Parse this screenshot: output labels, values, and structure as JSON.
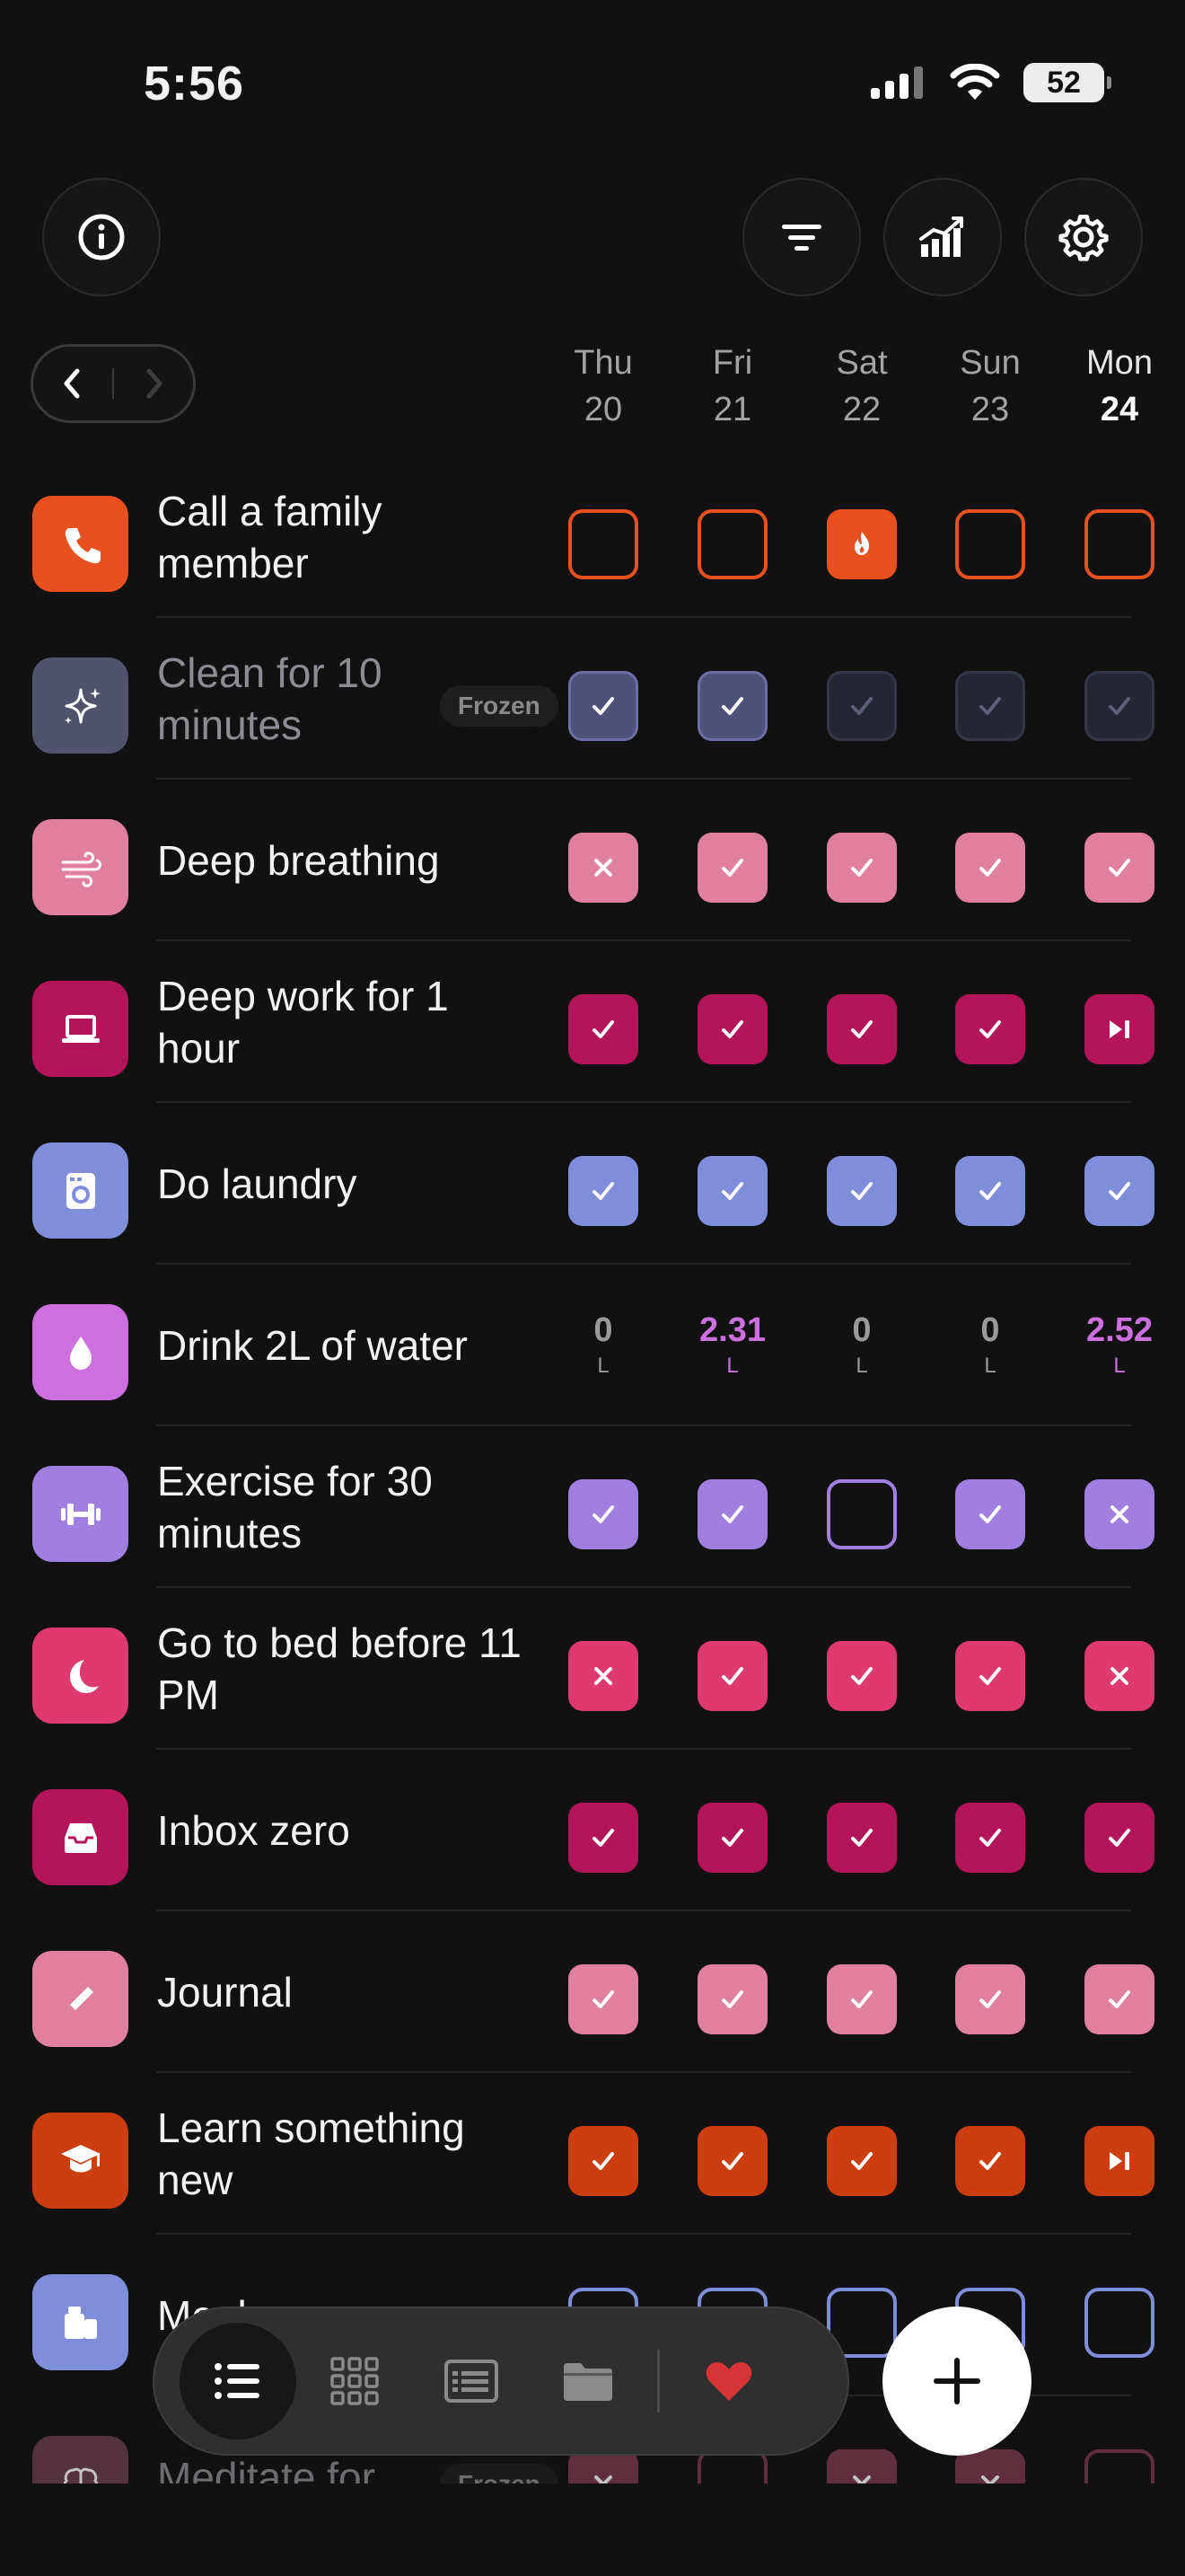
{
  "status_bar": {
    "time": "5:56",
    "battery": "52",
    "icons": [
      "signal-icon",
      "wifi-icon",
      "battery-icon"
    ]
  },
  "toolbar": {
    "left": [
      "info-icon"
    ],
    "right": [
      "filter-icon",
      "stats-icon",
      "settings-icon"
    ]
  },
  "week_nav": {
    "prev": "chevron-left-icon",
    "next": "chevron-right-icon"
  },
  "days": [
    {
      "name": "Thu",
      "num": "20"
    },
    {
      "name": "Fri",
      "num": "21"
    },
    {
      "name": "Sat",
      "num": "22"
    },
    {
      "name": "Sun",
      "num": "23"
    },
    {
      "name": "Mon",
      "num": "24",
      "today": true
    }
  ],
  "habits": [
    {
      "name": "Call a family member",
      "icon": "phone-icon",
      "color": "#e8501f",
      "cells": [
        "empty",
        "empty",
        "streak",
        "empty",
        "empty"
      ]
    },
    {
      "name": "Clean for 10 minutes",
      "icon": "sparkle-icon",
      "color": "#4e5179",
      "frozen": true,
      "badge": "Frozen",
      "cells": [
        "check",
        "check",
        "check-frozen",
        "check-frozen",
        "check-frozen"
      ]
    },
    {
      "name": "Deep breathing",
      "icon": "wind-icon",
      "color": "#e17f9e",
      "cells": [
        "x",
        "check",
        "check",
        "check",
        "check"
      ]
    },
    {
      "name": "Deep work for 1 hour",
      "icon": "laptop-icon",
      "color": "#b4145a",
      "cells": [
        "check",
        "check",
        "check",
        "check",
        "skip"
      ]
    },
    {
      "name": "Do laundry",
      "icon": "washer-icon",
      "color": "#7e8edb",
      "cells": [
        "check",
        "check",
        "check",
        "check",
        "check"
      ]
    },
    {
      "name": "Drink 2L of water",
      "icon": "drop-icon",
      "color": "#cd6fdf",
      "values": [
        "0",
        "2.31",
        "0",
        "0",
        "2.52"
      ],
      "unit": "L"
    },
    {
      "name": "Exercise for 30 minutes",
      "icon": "dumbbell-icon",
      "color": "#a17fe0",
      "cells": [
        "check",
        "check",
        "empty",
        "check",
        "x"
      ]
    },
    {
      "name": "Go to bed before 11 PM",
      "icon": "moon-icon",
      "color": "#de3a70",
      "cells": [
        "x",
        "check",
        "check",
        "check",
        "x"
      ]
    },
    {
      "name": "Inbox zero",
      "icon": "inbox-icon",
      "color": "#b4145a",
      "cells": [
        "check",
        "check",
        "check",
        "check",
        "check"
      ]
    },
    {
      "name": "Journal",
      "icon": "pencil-icon",
      "color": "#e17f9e",
      "cells": [
        "check",
        "check",
        "check",
        "check",
        "check"
      ]
    },
    {
      "name": "Learn something new",
      "icon": "graduation-cap-icon",
      "color": "#cc3d10",
      "cells": [
        "check",
        "check",
        "check",
        "check",
        "skip"
      ]
    },
    {
      "name": "Meal prep",
      "icon": "meal-icon",
      "color": "#7e8edb",
      "cells": [
        "empty",
        "empty",
        "empty",
        "empty",
        "empty"
      ]
    },
    {
      "name": "Meditate for",
      "icon": "brain-icon",
      "color": "#7a3a4e",
      "frozen": true,
      "badge": "Frozen",
      "cells": [
        "x",
        "empty",
        "x",
        "x",
        "empty"
      ]
    }
  ],
  "tabbar": {
    "tabs": [
      "list-icon",
      "grid-icon",
      "journal-icon",
      "folder-icon",
      "heart-icon"
    ],
    "active": 0
  },
  "fab": "plus-icon"
}
